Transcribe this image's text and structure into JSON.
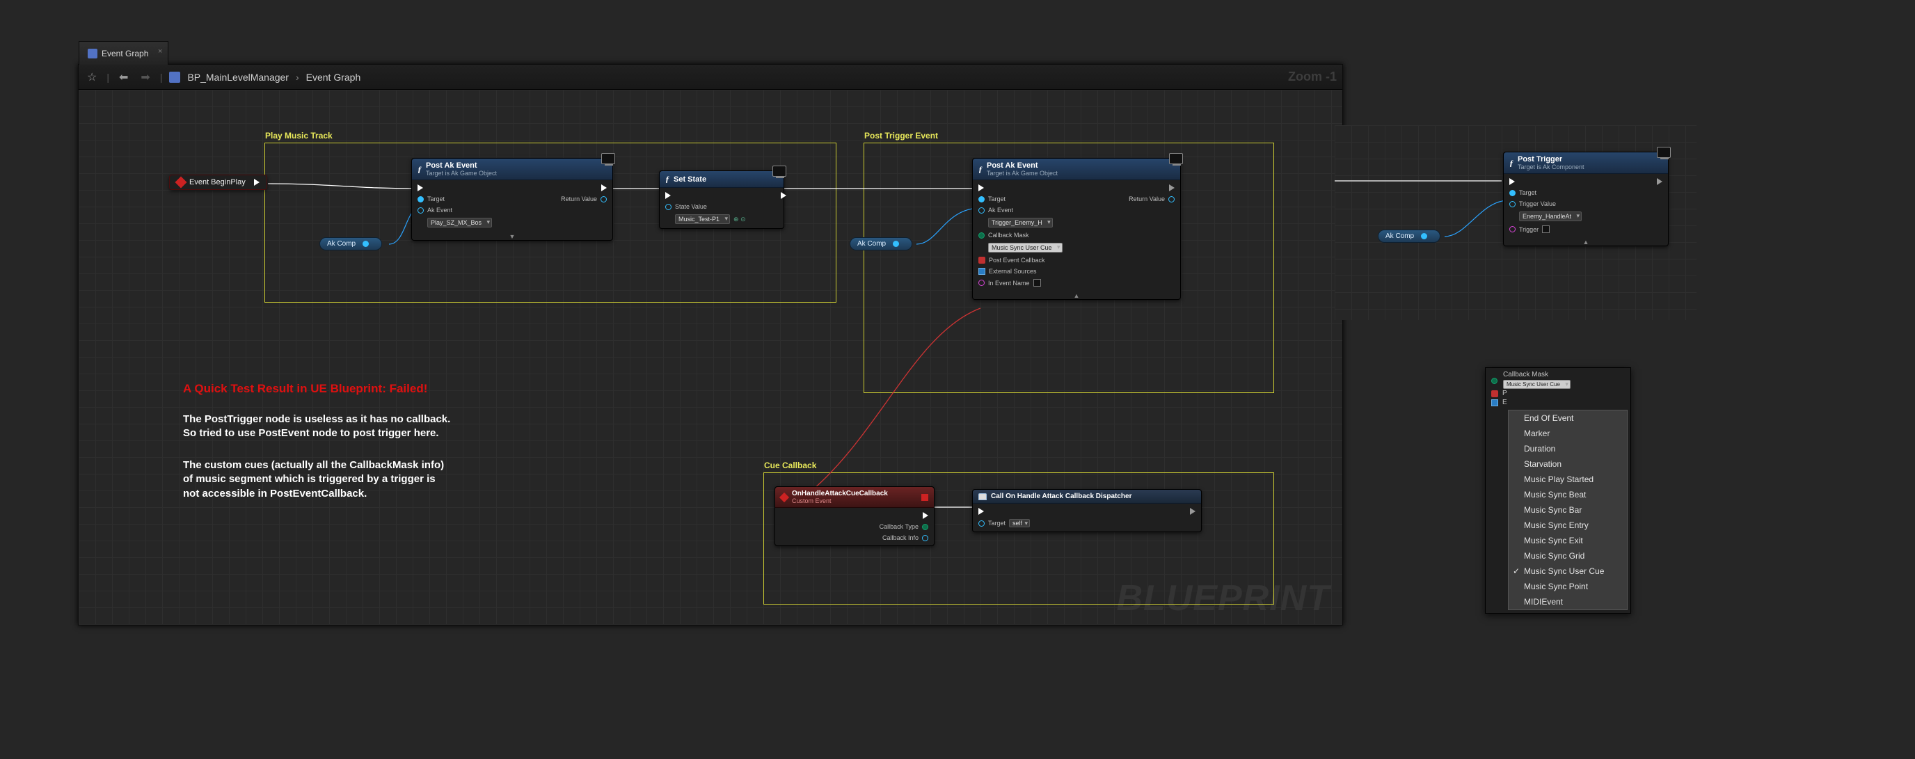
{
  "tab": {
    "label": "Event Graph"
  },
  "nav": {
    "parent": "BP_MainLevelManager",
    "current": "Event Graph",
    "zoom": "Zoom -1"
  },
  "watermark": "BLUEPRINT",
  "comments": {
    "play_music": "Play Music Track",
    "post_trigger": "Post Trigger Event",
    "cue_callback": "Cue Callback"
  },
  "event_begin": "Event BeginPlay",
  "ak_comp_chip": "Ak Comp",
  "nodes": {
    "post_ak_1": {
      "title": "Post Ak Event",
      "sub": "Target is Ak Game Object",
      "target": "Target",
      "ak_event": "Ak Event",
      "ak_event_val": "Play_SZ_MX_Bos",
      "return": "Return Value"
    },
    "set_state": {
      "title": "Set State",
      "state_value": "State Value",
      "state_value_val": "Music_Test-P1"
    },
    "post_ak_2": {
      "title": "Post Ak Event",
      "sub": "Target is Ak Game Object",
      "target": "Target",
      "ak_event": "Ak Event",
      "ak_event_val": "Trigger_Enemy_H",
      "cb_mask": "Callback Mask",
      "cb_mask_val": "Music Sync User Cue",
      "post_cb": "Post Event Callback",
      "ext_src": "External Sources",
      "in_evt": "In Event Name",
      "return": "Return Value"
    },
    "cue_cb": {
      "title": "OnHandleAttackCueCallback",
      "sub": "Custom Event",
      "cb_type": "Callback Type",
      "cb_info": "Callback Info"
    },
    "dispatch": {
      "title": "Call On Handle Attack Callback Dispatcher",
      "target": "Target",
      "target_val": "self"
    },
    "post_trigger": {
      "title": "Post Trigger",
      "sub": "Target is Ak Component",
      "target": "Target",
      "trig_val_lbl": "Trigger Value",
      "trig_val": "Enemy_HandleAt",
      "trigger": "Trigger"
    }
  },
  "overlay": {
    "red": "A Quick Test Result in UE Blueprint: Failed!",
    "white1": "The PostTrigger node is useless as it has no callback.\nSo tried to use PostEvent node to post trigger here.",
    "white2": "The custom cues (actually all the CallbackMask info)\nof music segment which is triggered by a trigger is\nnot accessible in PostEventCallback."
  },
  "cmask_popup": {
    "label": "Callback Mask",
    "selected": "Music Sync User Cue",
    "p_row": "P",
    "e_row": "E",
    "options": [
      "End Of Event",
      "Marker",
      "Duration",
      "Starvation",
      "Music Play Started",
      "Music Sync Beat",
      "Music Sync Bar",
      "Music Sync Entry",
      "Music Sync Exit",
      "Music Sync Grid",
      "Music Sync User Cue",
      "Music Sync Point",
      "MIDIEvent"
    ]
  }
}
